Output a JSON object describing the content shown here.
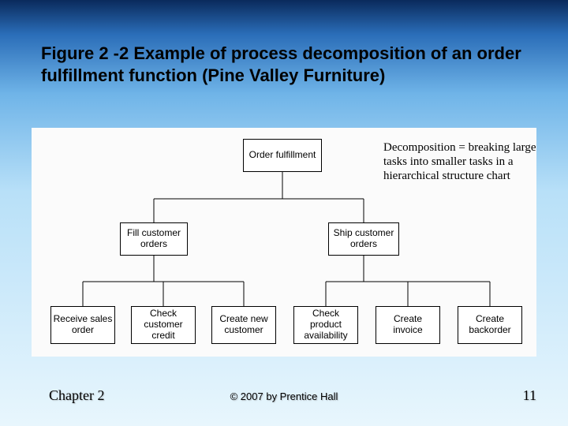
{
  "title": "Figure 2 -2 Example of process decomposition of an order fulfillment function (Pine Valley Furniture)",
  "annotation": "Decomposition = breaking large tasks into smaller tasks in a hierarchical structure chart",
  "footer": {
    "chapter": "Chapter 2",
    "copyright": "© 2007 by Prentice Hall",
    "page": "11"
  },
  "tree": {
    "root": {
      "label": "Order fulfillment"
    },
    "level1": [
      {
        "label": "Fill customer orders"
      },
      {
        "label": "Ship customer orders"
      }
    ],
    "level2": [
      {
        "label": "Receive sales order"
      },
      {
        "label": "Check customer credit"
      },
      {
        "label": "Create new customer"
      },
      {
        "label": "Check product availability"
      },
      {
        "label": "Create invoice"
      },
      {
        "label": "Create backorder"
      }
    ]
  }
}
